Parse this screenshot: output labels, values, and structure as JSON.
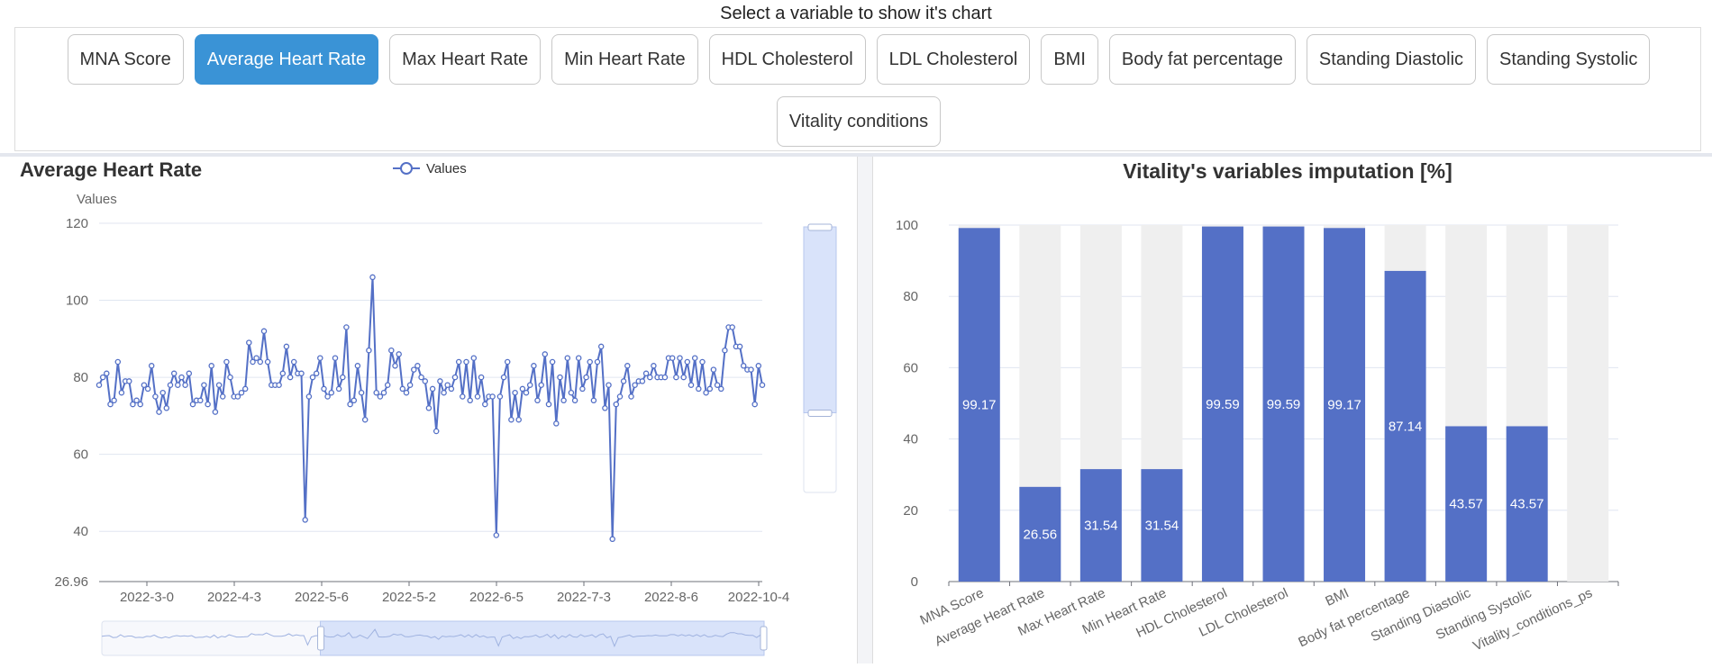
{
  "prompt": "Select a variable to show it's chart",
  "buttons": [
    {
      "label": "MNA Score",
      "active": false
    },
    {
      "label": "Average Heart Rate",
      "active": true
    },
    {
      "label": "Max Heart Rate",
      "active": false
    },
    {
      "label": "Min Heart Rate",
      "active": false
    },
    {
      "label": "HDL Cholesterol",
      "active": false
    },
    {
      "label": "LDL Cholesterol",
      "active": false
    },
    {
      "label": "BMI",
      "active": false
    },
    {
      "label": "Body fat percentage",
      "active": false
    },
    {
      "label": "Standing Diastolic",
      "active": false
    },
    {
      "label": "Standing Systolic",
      "active": false
    },
    {
      "label": "Vitality conditions",
      "active": false
    }
  ],
  "colors": {
    "accent": "#3a93d6",
    "series": "#5470c6",
    "bar_bg": "#efefef"
  },
  "chart_data": [
    {
      "type": "line",
      "title": "Average Heart Rate",
      "legend": [
        "Values"
      ],
      "legend_position": "top-center",
      "ylabel": "Values",
      "ylim": [
        26.96,
        120
      ],
      "yticks": [
        "26.96",
        "40",
        "60",
        "80",
        "100",
        "120"
      ],
      "xticks": [
        "2022-3-0",
        "2022-4-3",
        "2022-5-6",
        "2022-5-2",
        "2022-6-5",
        "2022-7-3",
        "2022-8-6",
        "2022-10-4"
      ],
      "datazoom": {
        "horizontal_window": [
          0.33,
          1.0
        ],
        "vertical_window": [
          0.0,
          0.7
        ]
      },
      "series": [
        {
          "name": "Values",
          "values": [
            78,
            80,
            81,
            73,
            74,
            84,
            76,
            79,
            79,
            73,
            74,
            73,
            78,
            77,
            83,
            75,
            71,
            76,
            72,
            78,
            81,
            78,
            80,
            78,
            81,
            73,
            74,
            74,
            78,
            73,
            83,
            71,
            78,
            75,
            84,
            80,
            75,
            75,
            76,
            77,
            89,
            84,
            85,
            84,
            92,
            84,
            78,
            78,
            78,
            81,
            88,
            80,
            84,
            81,
            81,
            43,
            75,
            80,
            81,
            85,
            77,
            75,
            76,
            85,
            77,
            80,
            93,
            73,
            74,
            83,
            76,
            69,
            87,
            106,
            76,
            75,
            76,
            78,
            87,
            83,
            86,
            77,
            76,
            78,
            82,
            83,
            80,
            79,
            72,
            77,
            66,
            79,
            76,
            78,
            77,
            80,
            84,
            75,
            84,
            74,
            85,
            75,
            80,
            73,
            75,
            75,
            39,
            75,
            80,
            84,
            69,
            76,
            69,
            77,
            76,
            78,
            83,
            74,
            78,
            86,
            73,
            84,
            68,
            80,
            74,
            85,
            76,
            74,
            85,
            77,
            80,
            84,
            74,
            84,
            88,
            72,
            78,
            38,
            73,
            75,
            79,
            83,
            75,
            78,
            79,
            79,
            81,
            80,
            83,
            80,
            80,
            80,
            85,
            85,
            80,
            85,
            80,
            84,
            78,
            85,
            77,
            84,
            76,
            77,
            82,
            78,
            77,
            87,
            93,
            93,
            88,
            88,
            83,
            82,
            82,
            73,
            83,
            78
          ]
        }
      ]
    },
    {
      "type": "bar",
      "title": "Vitality's variables imputation [%]",
      "categories": [
        "MNA Score",
        "Average Heart Rate",
        "Max Heart Rate",
        "Min Heart Rate",
        "HDL Cholesterol",
        "LDL Cholesterol",
        "BMI",
        "Body fat percentage",
        "Standing Diastolic",
        "Standing Systolic",
        "Vitality_conditions_ps"
      ],
      "values": [
        99.17,
        26.56,
        31.54,
        31.54,
        99.59,
        99.59,
        99.17,
        87.14,
        43.57,
        43.57,
        0
      ],
      "data_labels": [
        "99.17",
        "26.56",
        "31.54",
        "31.54",
        "99.59",
        "99.59",
        "99.17",
        "87.14",
        "43.57",
        "43.57",
        ""
      ],
      "ylim": [
        0,
        100
      ],
      "yticks": [
        "0",
        "20",
        "40",
        "60",
        "80",
        "100"
      ],
      "background_bars": true
    }
  ]
}
